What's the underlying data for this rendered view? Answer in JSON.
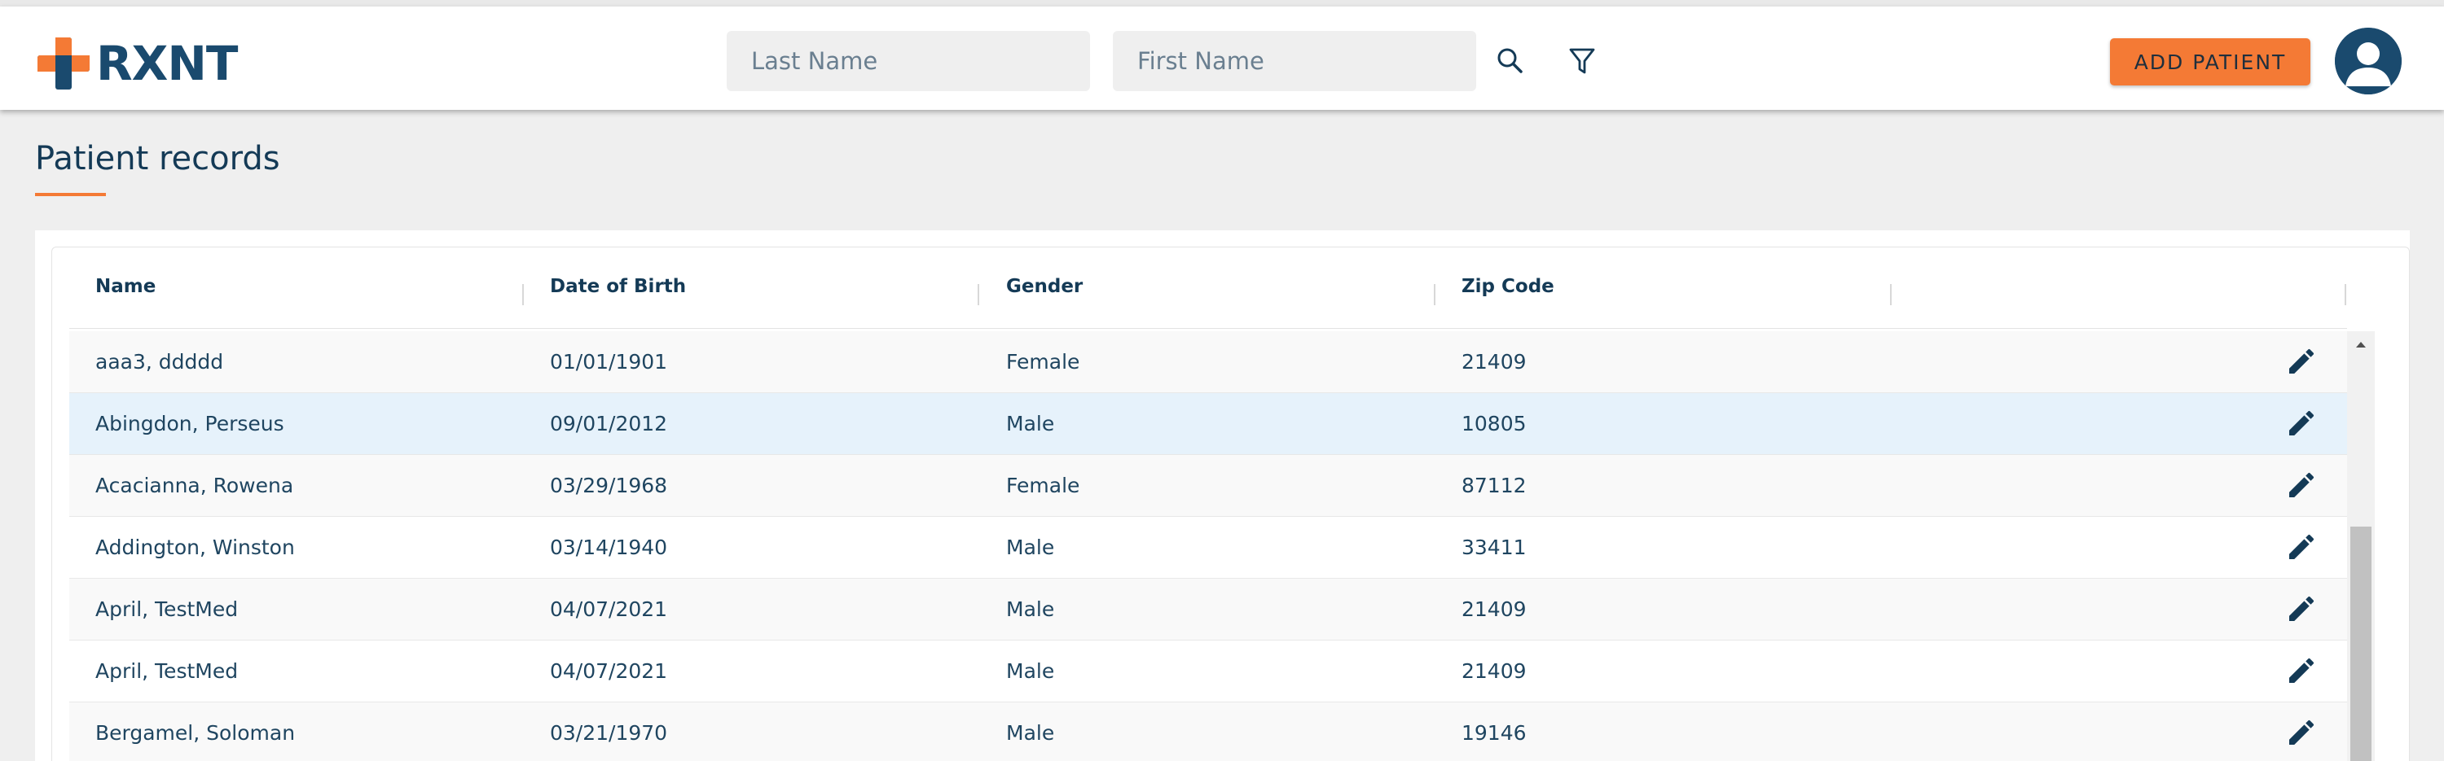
{
  "brand": {
    "name": "RXNT",
    "colors": {
      "accent": "#f47a35",
      "primary": "#1a4a6e",
      "selected_row": "#e6f2fb"
    }
  },
  "header": {
    "search": {
      "last_name_placeholder": "Last Name",
      "first_name_placeholder": "First Name"
    },
    "icons": {
      "search": "search-icon",
      "filter": "filter-icon",
      "avatar": "user-avatar-icon"
    },
    "add_patient_label": "ADD PATIENT"
  },
  "page": {
    "title": "Patient records"
  },
  "table": {
    "columns": [
      "Name",
      "Date of Birth",
      "Gender",
      "Zip Code",
      ""
    ],
    "rows": [
      {
        "name": "aaa3, ddddd",
        "dob": "01/01/1901",
        "gender": "Female",
        "zip": "21409"
      },
      {
        "name": "Abingdon, Perseus",
        "dob": "09/01/2012",
        "gender": "Male",
        "zip": "10805",
        "selected": true
      },
      {
        "name": "Acacianna, Rowena",
        "dob": "03/29/1968",
        "gender": "Female",
        "zip": "87112"
      },
      {
        "name": "Addington, Winston",
        "dob": "03/14/1940",
        "gender": "Male",
        "zip": "33411"
      },
      {
        "name": "April, TestMed",
        "dob": "04/07/2021",
        "gender": "Male",
        "zip": "21409"
      },
      {
        "name": "April, TestMed",
        "dob": "04/07/2021",
        "gender": "Male",
        "zip": "21409"
      },
      {
        "name": "Bergamel, Soloman",
        "dob": "03/21/1970",
        "gender": "Male",
        "zip": "19146"
      }
    ],
    "row_action_icon": "pencil-edit-icon"
  }
}
